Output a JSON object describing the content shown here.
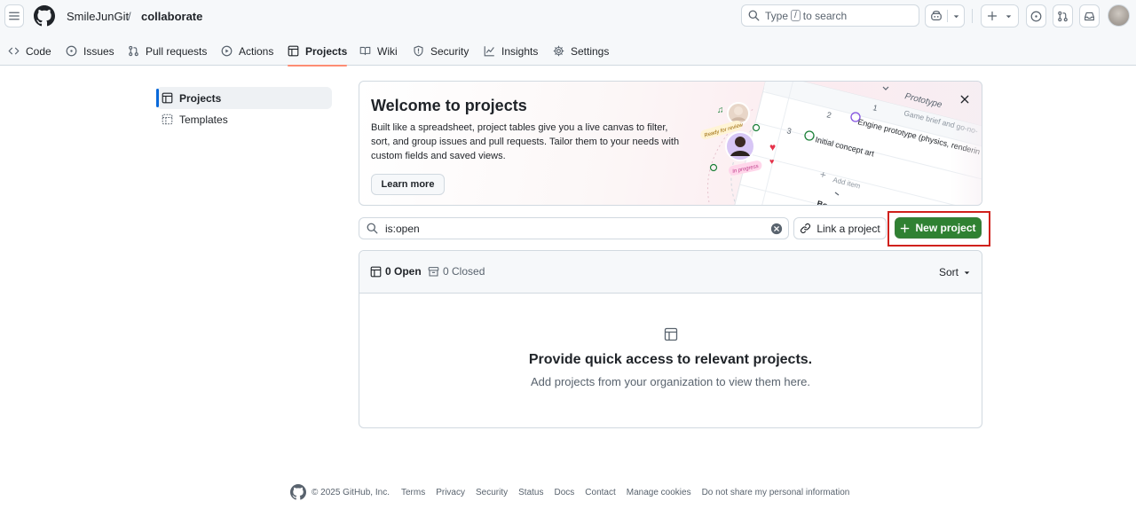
{
  "header": {
    "owner": "SmileJunGit",
    "separator": "/",
    "repo": "collaborate",
    "search": {
      "prefix": "Type",
      "key": "/",
      "suffix": "to search"
    }
  },
  "tabs": [
    {
      "label": "Code",
      "icon": "code-icon"
    },
    {
      "label": "Issues",
      "icon": "issue-icon"
    },
    {
      "label": "Pull requests",
      "icon": "pull-request-icon"
    },
    {
      "label": "Actions",
      "icon": "play-icon"
    },
    {
      "label": "Projects",
      "icon": "table-icon",
      "active": true
    },
    {
      "label": "Wiki",
      "icon": "book-icon"
    },
    {
      "label": "Security",
      "icon": "shield-icon"
    },
    {
      "label": "Insights",
      "icon": "graph-icon"
    },
    {
      "label": "Settings",
      "icon": "gear-icon"
    }
  ],
  "sidebar": {
    "items": [
      {
        "label": "Projects",
        "icon": "table-icon",
        "active": true
      },
      {
        "label": "Templates",
        "icon": "template-icon"
      }
    ]
  },
  "welcome": {
    "title": "Welcome to projects",
    "body": "Built like a spreadsheet, project tables give you a live canvas to filter, sort, and group issues and pull requests. Tailor them to your needs with custom fields and saved views.",
    "learn_more": "Learn more",
    "illustration": {
      "badges": [
        "Ready for review",
        "In progress"
      ],
      "header": "Prototype",
      "rows": [
        {
          "num": "1",
          "text": "Game brief and go-no-"
        },
        {
          "num": "2",
          "text": "Engine prototype (physics, renderin"
        },
        {
          "num": "3",
          "text": "Initial concept art"
        }
      ],
      "add_item": "Add item",
      "footer": "Bo"
    }
  },
  "filter": {
    "value": "is:open",
    "link_project": "Link a project",
    "new_project": "New project"
  },
  "projects": {
    "open_label": "0 Open",
    "closed_label": "0 Closed",
    "sort_label": "Sort",
    "empty_title": "Provide quick access to relevant projects.",
    "empty_desc": "Add projects from your organization to view them here."
  },
  "footer": {
    "copyright": "© 2025 GitHub, Inc.",
    "links": [
      "Terms",
      "Privacy",
      "Security",
      "Status",
      "Docs",
      "Contact",
      "Manage cookies",
      "Do not share my personal information"
    ]
  },
  "colors": {
    "accent": "#0969da",
    "primary_button": "#2f8132",
    "tab_underline": "#fd8c73",
    "highlight_box": "#d0211c"
  }
}
